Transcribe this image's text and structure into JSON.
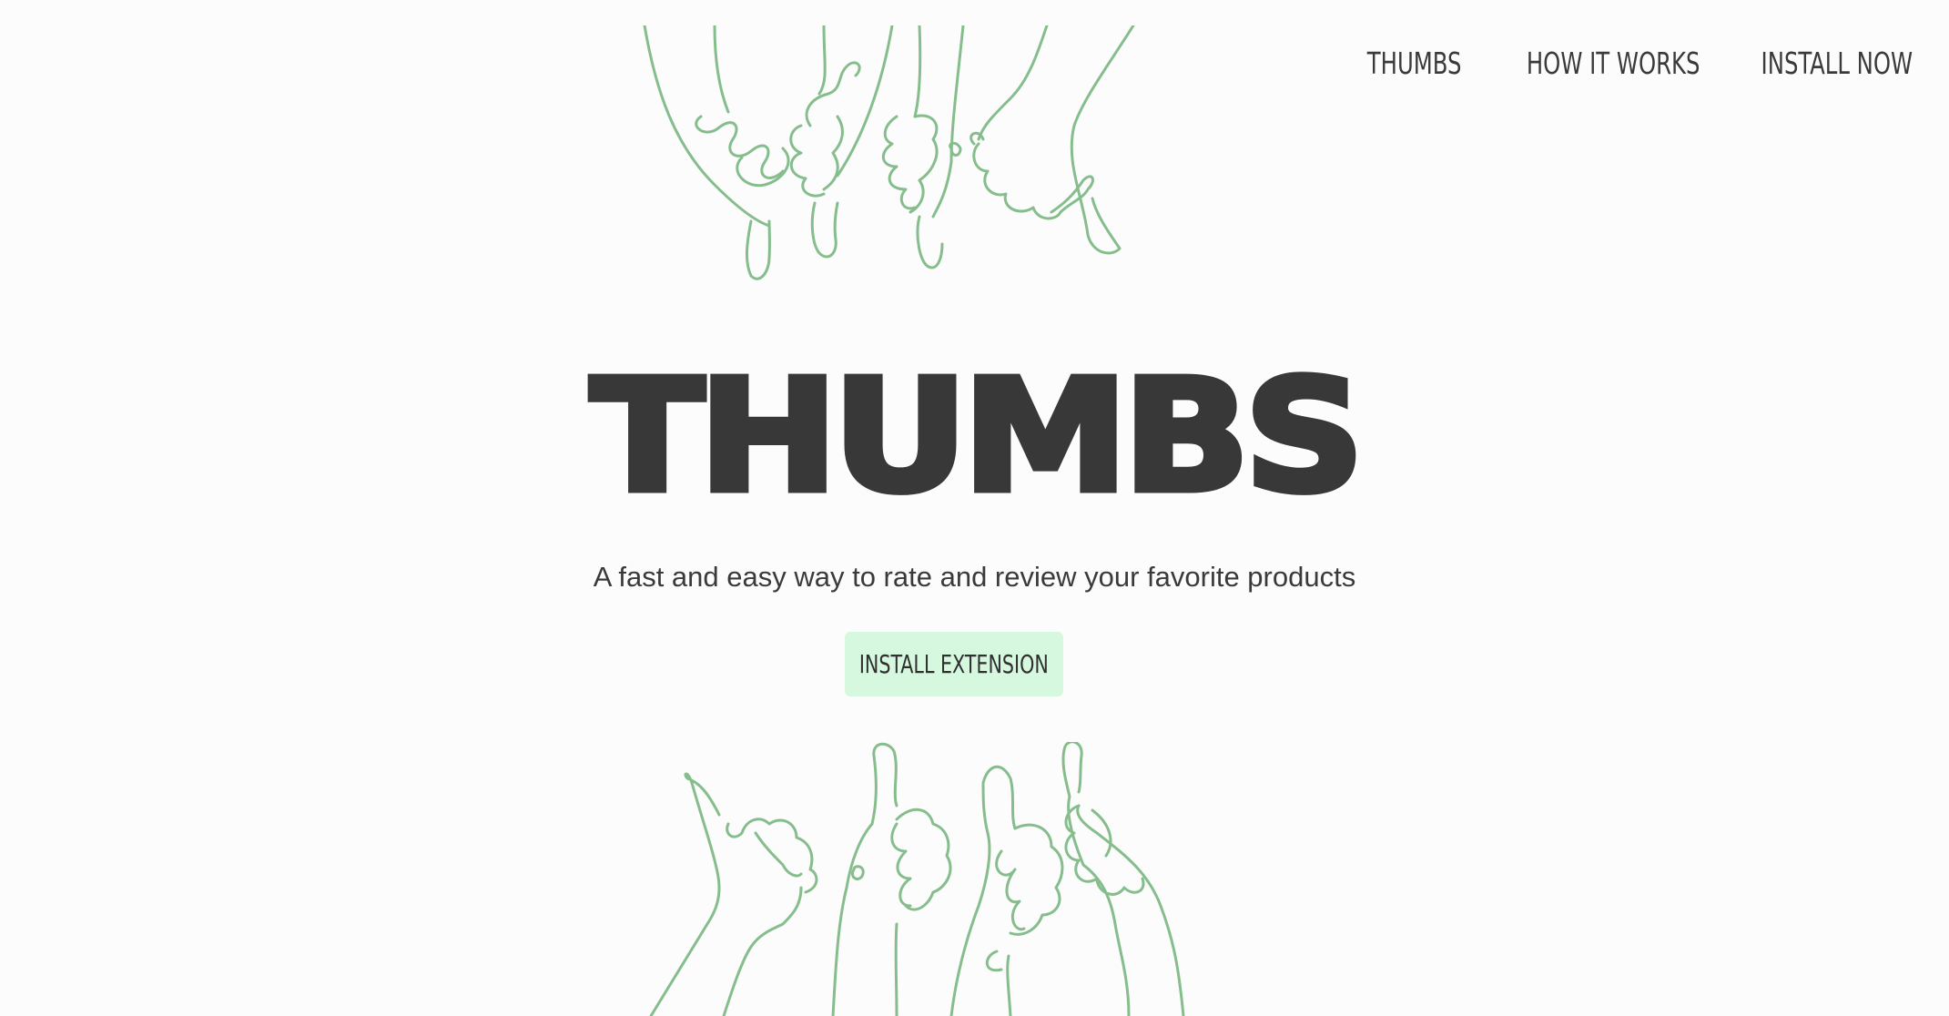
{
  "nav": {
    "items": [
      {
        "label": "THUMBS"
      },
      {
        "label": "HOW IT WORKS"
      },
      {
        "label": "INSTALL NOW"
      }
    ]
  },
  "hero": {
    "title": "THUMBS",
    "subtitle": "A fast and easy way to rate and review your favorite products",
    "cta_label": "INSTALL EXTENSION"
  },
  "illustrations": {
    "top": "thumbs-down-hands-icon",
    "bottom": "thumbs-up-hands-icon"
  },
  "colors": {
    "background": "#fcfcfc",
    "text": "#383838",
    "accent_line": "#86bd8c",
    "cta_background": "#d6f8de"
  }
}
